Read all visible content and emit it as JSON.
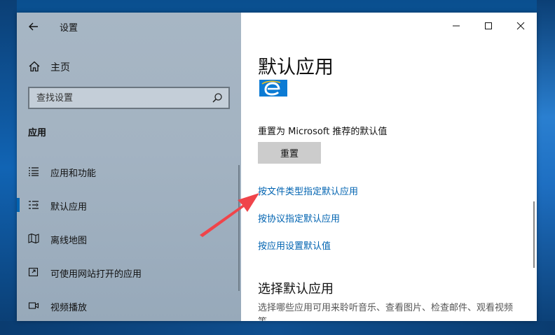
{
  "window": {
    "title": "设置"
  },
  "sidebar": {
    "home_label": "主页",
    "search_placeholder": "查找设置",
    "section_header": "应用",
    "items": [
      {
        "label": "应用和功能",
        "icon": "list-icon",
        "selected": false
      },
      {
        "label": "默认应用",
        "icon": "default-apps-icon",
        "selected": true
      },
      {
        "label": "离线地图",
        "icon": "map-icon",
        "selected": false
      },
      {
        "label": "可使用网站打开的应用",
        "icon": "open-with-icon",
        "selected": false
      },
      {
        "label": "视频播放",
        "icon": "video-icon",
        "selected": false
      }
    ]
  },
  "main": {
    "page_title": "默认应用",
    "browser_icon": "edge-browser-icon",
    "reset_label": "重置为 Microsoft 推荐的默认值",
    "reset_button": "重置",
    "links": [
      "按文件类型指定默认应用",
      "按协议指定默认应用",
      "按应用设置默认值"
    ],
    "sub_title": "选择默认应用",
    "sub_desc": "选择哪些应用可用来聆听音乐、查看图片、检查邮件、观看视频等。"
  },
  "colors": {
    "accent": "#0063b1",
    "sidebar_bg": "#a3b3c2",
    "annotation_arrow": "#f0444a"
  }
}
